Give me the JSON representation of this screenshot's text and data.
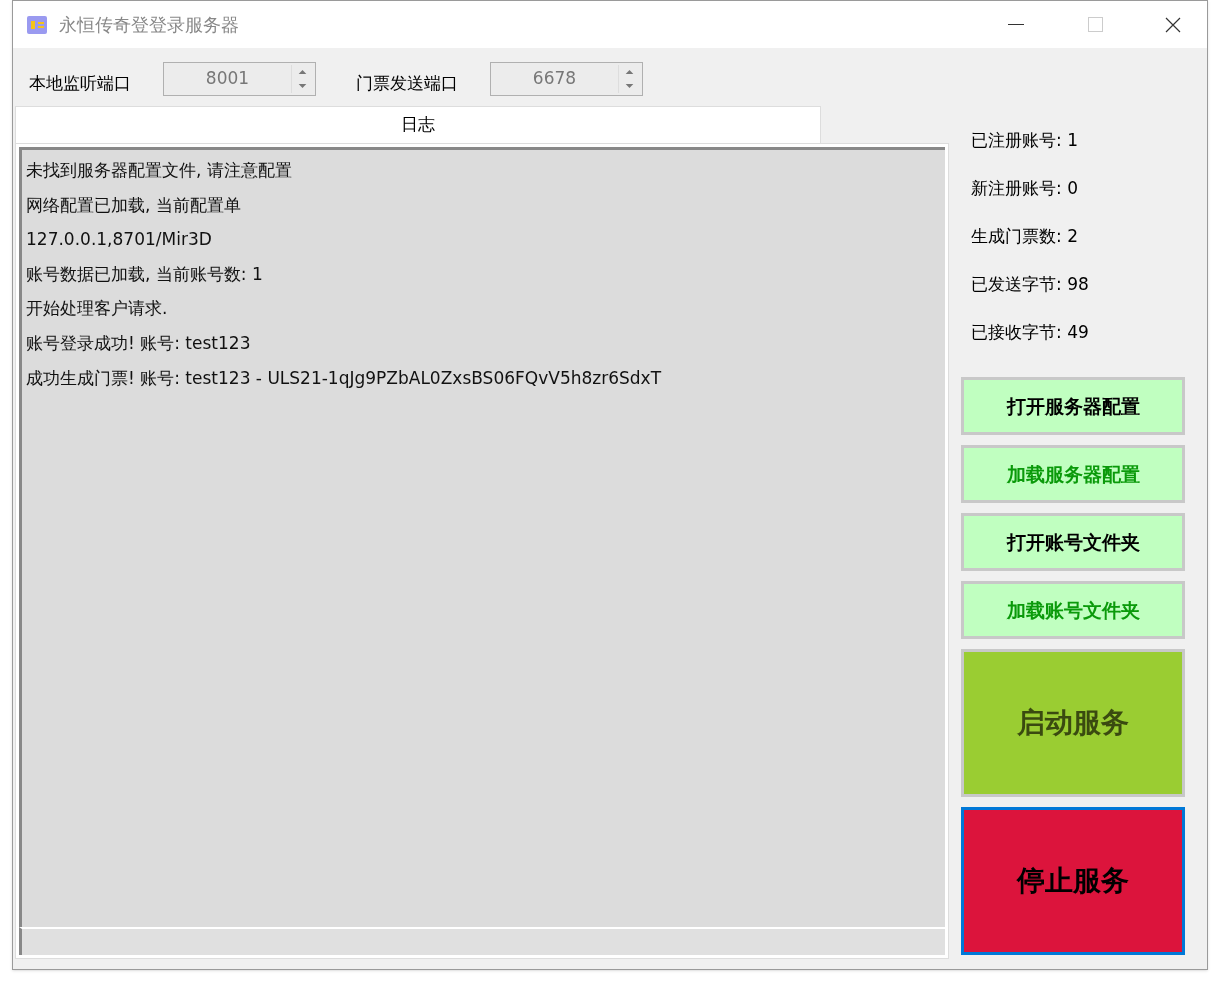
{
  "window": {
    "title": "永恒传奇登登录服务器"
  },
  "ports": [
    {
      "label": "本地监听端口",
      "value": "8001"
    },
    {
      "label": "门票发送端口",
      "value": "6678"
    }
  ],
  "tabs": [
    {
      "label": "日志",
      "selected": true
    }
  ],
  "log": [
    "未找到服务器配置文件, 请注意配置",
    "网络配置已加载, 当前配置单",
    "127.0.0.1,8701/Mir3D",
    "账号数据已加载, 当前账号数: 1",
    "开始处理客户请求.",
    "账号登录成功!  账号: test123",
    "成功生成门票!  账号: test123 - ULS21-1qJg9PZbAL0ZxsBS06FQvV5h8zr6SdxT"
  ],
  "stats": [
    "已注册账号: 1",
    "新注册账号: 0",
    "生成门票数: 2",
    "已发送字节: 98",
    "已接收字节: 49"
  ],
  "buttons": [
    {
      "label": "打开服务器配置",
      "kind": "open",
      "focused": false
    },
    {
      "label": "加载服务器配置",
      "kind": "load",
      "focused": false
    },
    {
      "label": "打开账号文件夹",
      "kind": "open",
      "focused": false
    },
    {
      "label": "加载账号文件夹",
      "kind": "load",
      "focused": false
    },
    {
      "label": "启动服务",
      "kind": "start",
      "focused": false
    },
    {
      "label": "停止服务",
      "kind": "stop",
      "focused": true
    }
  ]
}
